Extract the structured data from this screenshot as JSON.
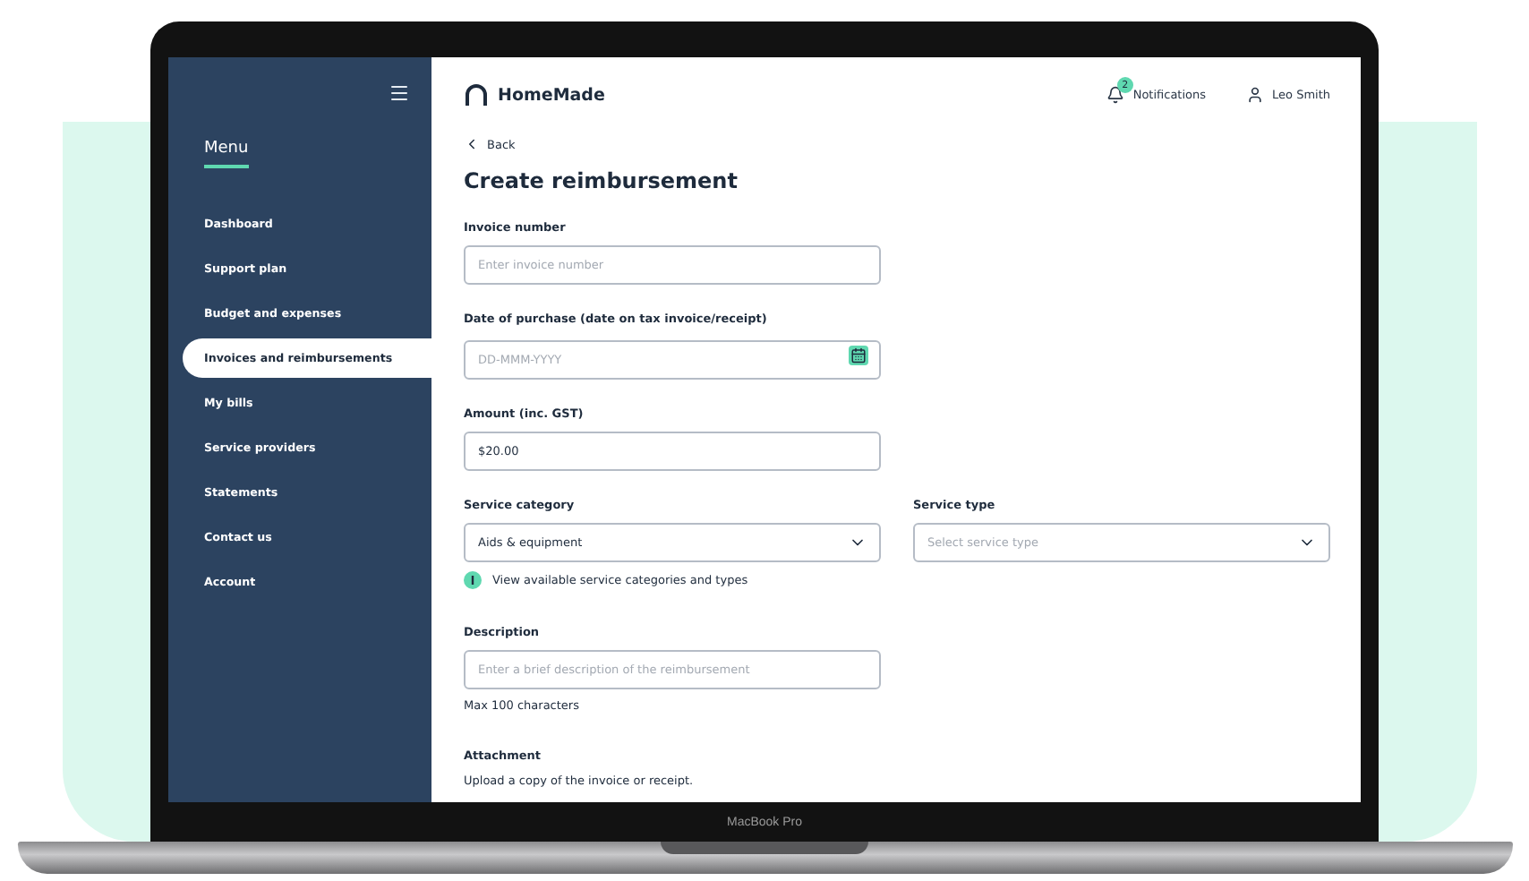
{
  "device": {
    "label": "MacBook Pro"
  },
  "sidebar": {
    "menu_title": "Menu",
    "items": [
      {
        "label": "Dashboard",
        "selected": false
      },
      {
        "label": "Support plan",
        "selected": false
      },
      {
        "label": "Budget and expenses",
        "selected": false
      },
      {
        "label": "Invoices and reimbursements",
        "selected": true
      },
      {
        "label": "My bills",
        "selected": false
      },
      {
        "label": "Service providers",
        "selected": false
      },
      {
        "label": "Statements",
        "selected": false
      },
      {
        "label": "Contact us",
        "selected": false
      },
      {
        "label": "Account",
        "selected": false
      }
    ]
  },
  "header": {
    "brand": "HomeMade",
    "notifications": {
      "label": "Notifications",
      "count": "2"
    },
    "user": "Leo Smith"
  },
  "back": "Back",
  "title": "Create reimbursement",
  "invoice_number": {
    "label": "Invoice number",
    "placeholder": "Enter invoice number"
  },
  "date_of_purchase": {
    "label": "Date of purchase (date on tax invoice/receipt)",
    "placeholder": "DD-MMM-YYYY"
  },
  "amount": {
    "label": "Amount (inc. GST)",
    "value": "$20.00"
  },
  "service_category": {
    "label": "Service category",
    "value": "Aids & equipment"
  },
  "service_type": {
    "label": "Service type",
    "placeholder": "Select service type"
  },
  "info_link": "View available service categories and types",
  "description": {
    "label": "Description",
    "placeholder": "Enter a brief description of the reimbursement",
    "hint": "Max 100 characters"
  },
  "attachment": {
    "label": "Attachment",
    "text": "Upload a copy of the invoice or receipt."
  }
}
